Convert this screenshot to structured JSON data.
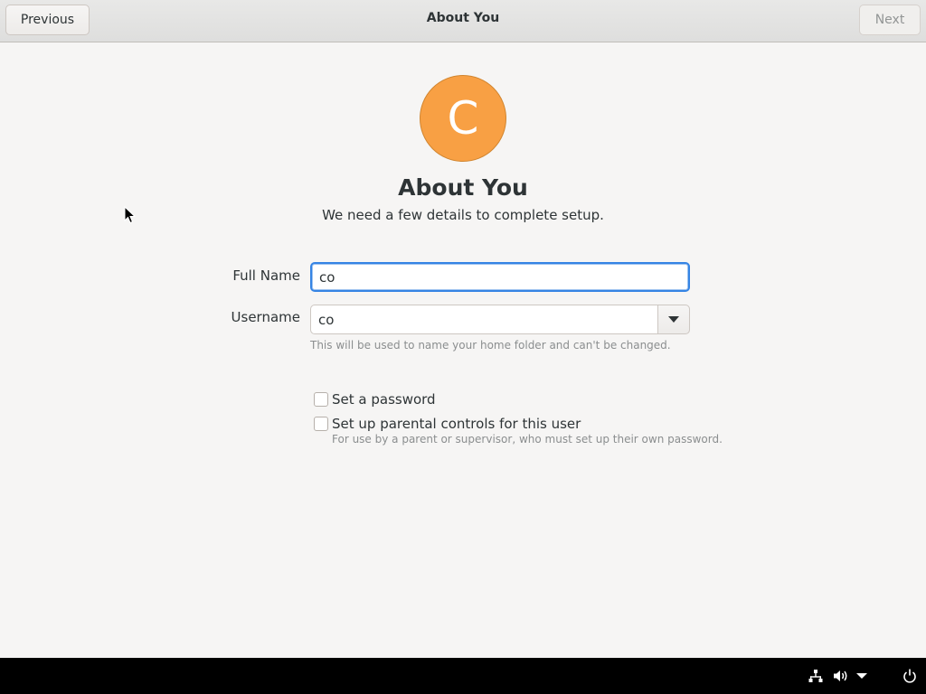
{
  "header": {
    "title": "About You",
    "previous_label": "Previous",
    "next_label": "Next"
  },
  "avatar": {
    "initial": "C",
    "color": "#f8a044"
  },
  "main": {
    "title": "About You",
    "subtitle": "We need a few details to complete setup."
  },
  "form": {
    "full_name_label": "Full Name",
    "full_name_value": "co",
    "username_label": "Username",
    "username_value": "co",
    "username_hint": "This will be used to name your home folder and can't be changed."
  },
  "options": {
    "set_password_label": "Set a password",
    "set_password_checked": false,
    "parental_label": "Set up parental controls for this user",
    "parental_checked": false,
    "parental_hint": "For use by a parent or supervisor, who must set up their own password."
  },
  "tray": {
    "icons": [
      "network-icon",
      "volume-icon",
      "system-menu-arrow-icon",
      "power-icon"
    ]
  },
  "colors": {
    "accent": "#3584e4",
    "panel": "#000000",
    "background": "#f6f5f4"
  }
}
